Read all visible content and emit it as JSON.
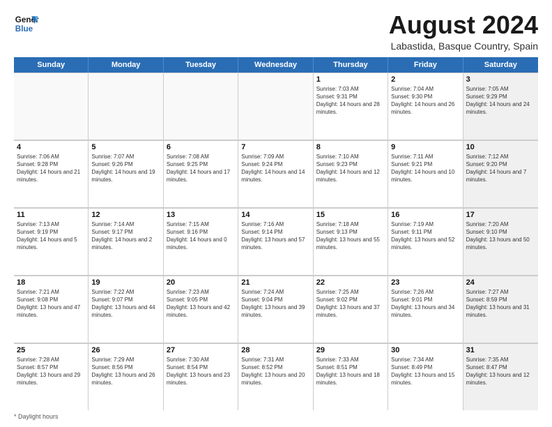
{
  "header": {
    "logo_line1": "General",
    "logo_line2": "Blue",
    "main_title": "August 2024",
    "subtitle": "Labastida, Basque Country, Spain"
  },
  "weekdays": [
    "Sunday",
    "Monday",
    "Tuesday",
    "Wednesday",
    "Thursday",
    "Friday",
    "Saturday"
  ],
  "weeks": [
    [
      {
        "day": "",
        "text": "",
        "empty": true
      },
      {
        "day": "",
        "text": "",
        "empty": true
      },
      {
        "day": "",
        "text": "",
        "empty": true
      },
      {
        "day": "",
        "text": "",
        "empty": true
      },
      {
        "day": "1",
        "text": "Sunrise: 7:03 AM\nSunset: 9:31 PM\nDaylight: 14 hours and 28 minutes.",
        "empty": false
      },
      {
        "day": "2",
        "text": "Sunrise: 7:04 AM\nSunset: 9:30 PM\nDaylight: 14 hours and 26 minutes.",
        "empty": false
      },
      {
        "day": "3",
        "text": "Sunrise: 7:05 AM\nSunset: 9:29 PM\nDaylight: 14 hours and 24 minutes.",
        "empty": false,
        "shaded": true
      }
    ],
    [
      {
        "day": "4",
        "text": "Sunrise: 7:06 AM\nSunset: 9:28 PM\nDaylight: 14 hours and 21 minutes.",
        "empty": false
      },
      {
        "day": "5",
        "text": "Sunrise: 7:07 AM\nSunset: 9:26 PM\nDaylight: 14 hours and 19 minutes.",
        "empty": false
      },
      {
        "day": "6",
        "text": "Sunrise: 7:08 AM\nSunset: 9:25 PM\nDaylight: 14 hours and 17 minutes.",
        "empty": false
      },
      {
        "day": "7",
        "text": "Sunrise: 7:09 AM\nSunset: 9:24 PM\nDaylight: 14 hours and 14 minutes.",
        "empty": false
      },
      {
        "day": "8",
        "text": "Sunrise: 7:10 AM\nSunset: 9:23 PM\nDaylight: 14 hours and 12 minutes.",
        "empty": false
      },
      {
        "day": "9",
        "text": "Sunrise: 7:11 AM\nSunset: 9:21 PM\nDaylight: 14 hours and 10 minutes.",
        "empty": false
      },
      {
        "day": "10",
        "text": "Sunrise: 7:12 AM\nSunset: 9:20 PM\nDaylight: 14 hours and 7 minutes.",
        "empty": false,
        "shaded": true
      }
    ],
    [
      {
        "day": "11",
        "text": "Sunrise: 7:13 AM\nSunset: 9:19 PM\nDaylight: 14 hours and 5 minutes.",
        "empty": false
      },
      {
        "day": "12",
        "text": "Sunrise: 7:14 AM\nSunset: 9:17 PM\nDaylight: 14 hours and 2 minutes.",
        "empty": false
      },
      {
        "day": "13",
        "text": "Sunrise: 7:15 AM\nSunset: 9:16 PM\nDaylight: 14 hours and 0 minutes.",
        "empty": false
      },
      {
        "day": "14",
        "text": "Sunrise: 7:16 AM\nSunset: 9:14 PM\nDaylight: 13 hours and 57 minutes.",
        "empty": false
      },
      {
        "day": "15",
        "text": "Sunrise: 7:18 AM\nSunset: 9:13 PM\nDaylight: 13 hours and 55 minutes.",
        "empty": false
      },
      {
        "day": "16",
        "text": "Sunrise: 7:19 AM\nSunset: 9:11 PM\nDaylight: 13 hours and 52 minutes.",
        "empty": false
      },
      {
        "day": "17",
        "text": "Sunrise: 7:20 AM\nSunset: 9:10 PM\nDaylight: 13 hours and 50 minutes.",
        "empty": false,
        "shaded": true
      }
    ],
    [
      {
        "day": "18",
        "text": "Sunrise: 7:21 AM\nSunset: 9:08 PM\nDaylight: 13 hours and 47 minutes.",
        "empty": false
      },
      {
        "day": "19",
        "text": "Sunrise: 7:22 AM\nSunset: 9:07 PM\nDaylight: 13 hours and 44 minutes.",
        "empty": false
      },
      {
        "day": "20",
        "text": "Sunrise: 7:23 AM\nSunset: 9:05 PM\nDaylight: 13 hours and 42 minutes.",
        "empty": false
      },
      {
        "day": "21",
        "text": "Sunrise: 7:24 AM\nSunset: 9:04 PM\nDaylight: 13 hours and 39 minutes.",
        "empty": false
      },
      {
        "day": "22",
        "text": "Sunrise: 7:25 AM\nSunset: 9:02 PM\nDaylight: 13 hours and 37 minutes.",
        "empty": false
      },
      {
        "day": "23",
        "text": "Sunrise: 7:26 AM\nSunset: 9:01 PM\nDaylight: 13 hours and 34 minutes.",
        "empty": false
      },
      {
        "day": "24",
        "text": "Sunrise: 7:27 AM\nSunset: 8:59 PM\nDaylight: 13 hours and 31 minutes.",
        "empty": false,
        "shaded": true
      }
    ],
    [
      {
        "day": "25",
        "text": "Sunrise: 7:28 AM\nSunset: 8:57 PM\nDaylight: 13 hours and 29 minutes.",
        "empty": false
      },
      {
        "day": "26",
        "text": "Sunrise: 7:29 AM\nSunset: 8:56 PM\nDaylight: 13 hours and 26 minutes.",
        "empty": false
      },
      {
        "day": "27",
        "text": "Sunrise: 7:30 AM\nSunset: 8:54 PM\nDaylight: 13 hours and 23 minutes.",
        "empty": false
      },
      {
        "day": "28",
        "text": "Sunrise: 7:31 AM\nSunset: 8:52 PM\nDaylight: 13 hours and 20 minutes.",
        "empty": false
      },
      {
        "day": "29",
        "text": "Sunrise: 7:33 AM\nSunset: 8:51 PM\nDaylight: 13 hours and 18 minutes.",
        "empty": false
      },
      {
        "day": "30",
        "text": "Sunrise: 7:34 AM\nSunset: 8:49 PM\nDaylight: 13 hours and 15 minutes.",
        "empty": false
      },
      {
        "day": "31",
        "text": "Sunrise: 7:35 AM\nSunset: 8:47 PM\nDaylight: 13 hours and 12 minutes.",
        "empty": false,
        "shaded": true
      }
    ]
  ],
  "footer": {
    "note": "Daylight hours"
  }
}
